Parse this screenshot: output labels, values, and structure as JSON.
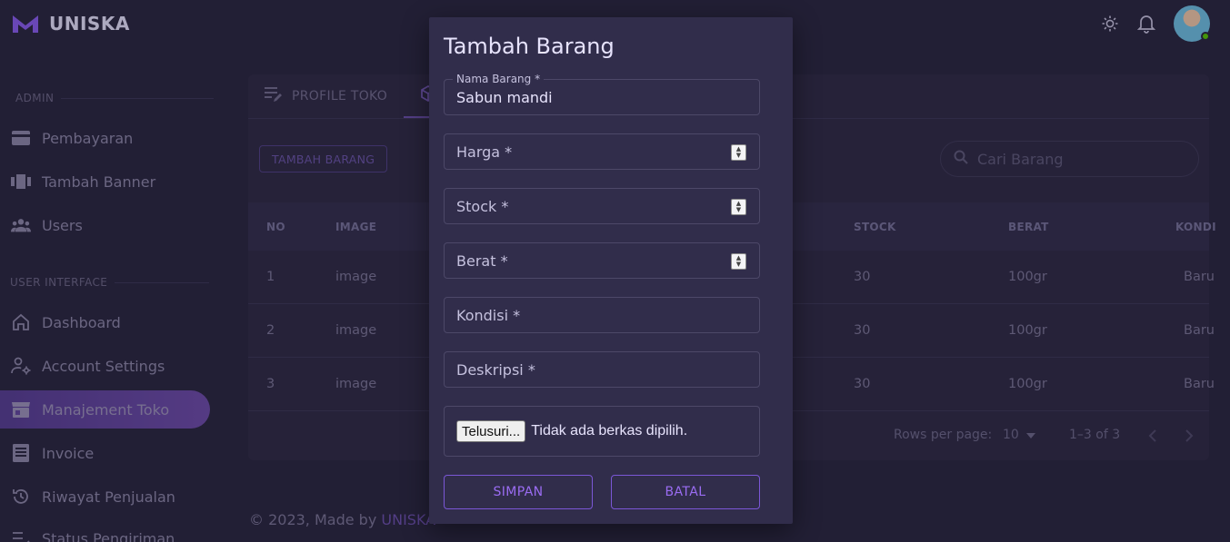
{
  "brand": {
    "name": "UNISKA"
  },
  "topbar": {
    "icons": [
      "sun-icon",
      "bell-icon"
    ],
    "avatar_status_color": "#56ca00"
  },
  "sidebar": {
    "sections": [
      {
        "label": "ADMIN"
      },
      {
        "label": "USER INTERFACE"
      }
    ],
    "items": [
      {
        "label": "Pembayaran",
        "icon": "credit-card-icon"
      },
      {
        "label": "Tambah Banner",
        "icon": "carousel-icon"
      },
      {
        "label": "Users",
        "icon": "users-icon"
      },
      {
        "label": "Dashboard",
        "icon": "home-icon"
      },
      {
        "label": "Account Settings",
        "icon": "account-cog-icon"
      },
      {
        "label": "Manajement Toko",
        "icon": "store-icon",
        "active": true
      },
      {
        "label": "Invoice",
        "icon": "invoice-icon"
      },
      {
        "label": "Riwayat Penjualan",
        "icon": "history-icon"
      },
      {
        "label": "Status Pengiriman",
        "icon": "list-check-icon"
      }
    ]
  },
  "main": {
    "tabs": [
      {
        "label": "PROFILE TOKO",
        "icon": "account-edit-icon"
      },
      {
        "label": "",
        "icon": "cube-icon",
        "active": true
      }
    ],
    "add_button": "TAMBAH BARANG",
    "search_placeholder": "Cari Barang",
    "table": {
      "columns": [
        "NO",
        "IMAGE",
        "STOCK",
        "BERAT",
        "KONDI"
      ],
      "rows": [
        [
          "1",
          "image",
          "30",
          "100gr",
          "Baru"
        ],
        [
          "2",
          "image",
          "30",
          "100gr",
          "Baru"
        ],
        [
          "3",
          "image",
          "30",
          "100gr",
          "Baru"
        ]
      ]
    },
    "pagination": {
      "rows_per_page_label": "Rows per page:",
      "rows_per_page_value": "10",
      "range": "1–3 of 3"
    }
  },
  "footer": {
    "text": "© 2023, Made by ",
    "link": "UNISKA"
  },
  "dialog": {
    "title": "Tambah Barang",
    "fields": [
      {
        "label": "Nama Barang *",
        "value": "Sabun mandi"
      },
      {
        "label": "Harga *",
        "value": ""
      },
      {
        "label": "Stock *",
        "value": ""
      },
      {
        "label": "Berat *",
        "value": ""
      },
      {
        "label": "Kondisi *",
        "value": ""
      },
      {
        "label": "Deskripsi *",
        "value": ""
      }
    ],
    "file": {
      "button": "Telusuri...",
      "status": "Tidak ada berkas dipilih."
    },
    "save_button": "SIMPAN",
    "cancel_button": "BATAL"
  },
  "colors": {
    "background": "#28243d",
    "accent": "#9155fd",
    "dialog": "#312d4b"
  }
}
